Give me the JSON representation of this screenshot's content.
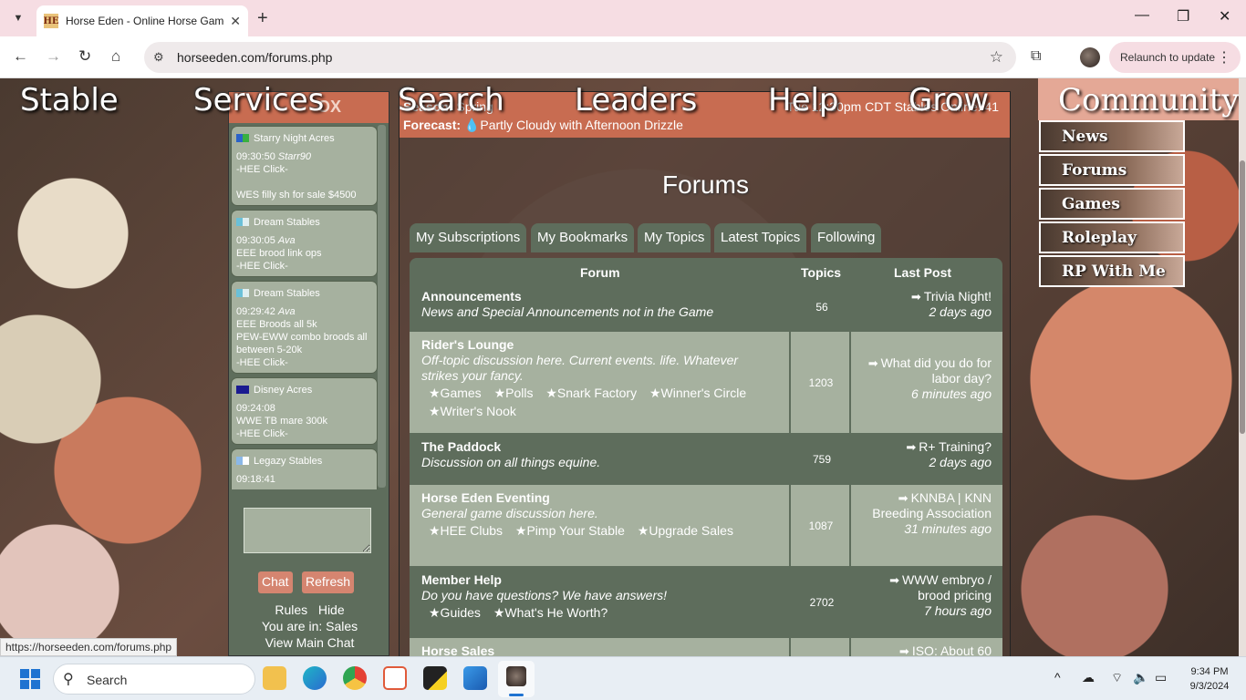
{
  "browser": {
    "tab_title": "Horse Eden - Online Horse Game",
    "tab_favicon": "HE",
    "url": "horseeden.com/forums.php",
    "relaunch": "Relaunch to update",
    "status_url": "https://horseeden.com/forums.php"
  },
  "topnav": [
    "Stable",
    "Services",
    "Search",
    "Leaders",
    "Help",
    "Grow"
  ],
  "chat": {
    "header": "OX",
    "messages": [
      {
        "stable": "Starry Night Acres",
        "time": "09:30:50",
        "user": "Starr90",
        "lines": [
          "-HEE Click-",
          "",
          "WES filly sh for sale $4500"
        ],
        "flag": "#2a62c8"
      },
      {
        "stable": "Dream Stables",
        "time": "09:30:05",
        "user": "Ava",
        "lines": [
          "EEE brood link ops",
          "-HEE Click-"
        ],
        "flag": "#6ac0d8"
      },
      {
        "stable": "Dream Stables",
        "time": "09:29:42",
        "user": "Ava",
        "lines": [
          "EEE Broods all 5k",
          "PEW-EWW combo broods all between 5-20k",
          "-HEE Click-"
        ],
        "flag": "#6ac0d8"
      },
      {
        "stable": "Disney Acres",
        "time": "09:24:08",
        "user": "",
        "lines": [
          "WWE TB mare 300k",
          "-HEE Click-"
        ],
        "flag": "#1a1a90"
      },
      {
        "stable": "Legazy Stables",
        "time": "09:18:41",
        "user": "",
        "lines": [],
        "flag": "#8ab8e8"
      }
    ],
    "chat_btn": "Chat",
    "refresh_btn": "Refresh",
    "rules": "Rules",
    "hide": "Hide",
    "you_are_in": "You are in: Sales",
    "view_main": "View Main Chat"
  },
  "header": {
    "season_label": "Season:",
    "season": "Spring",
    "forecast_label": "Forecast:",
    "forecast": "Partly Cloudy with Afternoon Drizzle",
    "right": "Tue 12:30pm CDT  Stables Online: 41"
  },
  "forums": {
    "title": "Forums",
    "tabs": [
      "My Subscriptions",
      "My Bookmarks",
      "My Topics",
      "Latest Topics",
      "Following"
    ],
    "col_forum": "Forum",
    "col_topics": "Topics",
    "col_last": "Last Post",
    "rows": [
      {
        "name": "Announcements",
        "desc": "News and Special Announcements not in the Game",
        "subs": [],
        "topics": "56",
        "last": "Trivia Night!",
        "ago": "2 days ago"
      },
      {
        "name": "Rider's Lounge",
        "desc": "Off-topic discussion here. Current events. life. Whatever strikes your fancy.",
        "subs": [
          "★Games",
          "★Polls",
          "★Snark Factory",
          "★Winner's Circle",
          "★Writer's Nook"
        ],
        "topics": "1203",
        "last": "What did you do for labor day?",
        "ago": "6 minutes ago"
      },
      {
        "name": "The Paddock",
        "desc": "Discussion on all things equine.",
        "subs": [],
        "topics": "759",
        "last": "R+ Training?",
        "ago": "2 days ago"
      },
      {
        "name": "Horse Eden Eventing",
        "desc": "General game discussion here.",
        "subs": [
          "★HEE Clubs",
          "★Pimp Your Stable",
          "★Upgrade Sales"
        ],
        "topics": "1087",
        "last": "KNNBA | KNN Breeding Association",
        "ago": "31 minutes ago"
      },
      {
        "name": "Member Help",
        "desc": "Do you have questions? We have answers!",
        "subs": [
          "★Guides",
          "★What's He Worth?"
        ],
        "topics": "2702",
        "last": "WWW embryo / brood pricing",
        "ago": "7 hours ago"
      },
      {
        "name": "Horse Sales",
        "desc": "",
        "subs": [],
        "topics": "",
        "last": "ISO: About 60",
        "ago": ""
      }
    ]
  },
  "community": {
    "title": "Community",
    "items": [
      "News",
      "Forums",
      "Games",
      "Roleplay",
      "RP With Me"
    ]
  },
  "taskbar": {
    "search": "Search",
    "time": "9:34 PM",
    "date": "9/3/2024"
  }
}
